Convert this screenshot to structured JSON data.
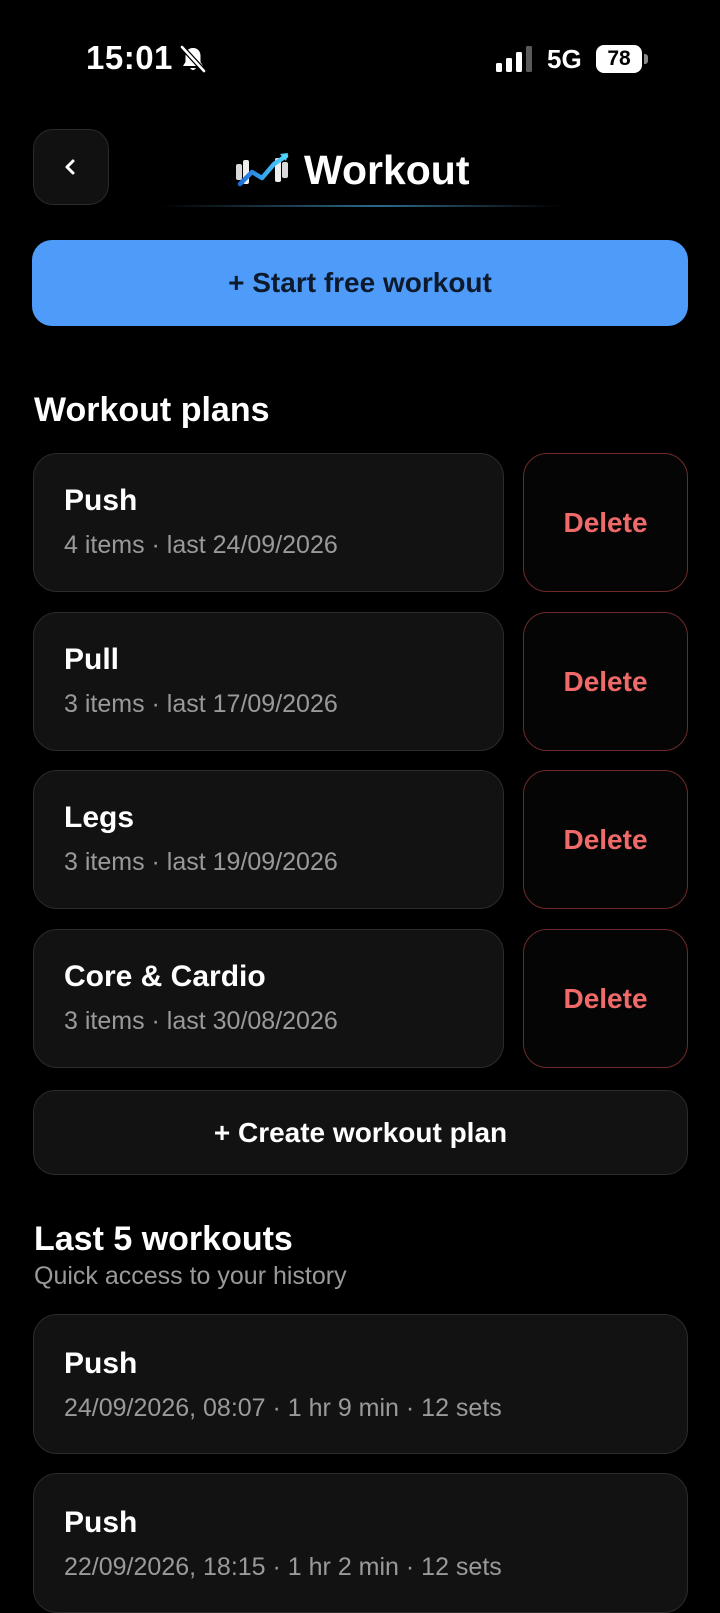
{
  "status_bar": {
    "time": "15:01",
    "network": "5G",
    "battery": "78",
    "icons": [
      "bell-slash-icon",
      "cellular-signal-icon",
      "battery-icon"
    ]
  },
  "header": {
    "back_icon": "chevron-left-icon",
    "logo_icon": "dumbbell-chart-logo-icon",
    "title": "Workout"
  },
  "start_button": {
    "label": "+ Start free workout"
  },
  "plans": {
    "title": "Workout plans",
    "delete_label": "Delete",
    "items": [
      {
        "name": "Push",
        "meta": "4 items · last 24/09/2026"
      },
      {
        "name": "Pull",
        "meta": "3 items · last 17/09/2026"
      },
      {
        "name": "Legs",
        "meta": "3 items · last 19/09/2026"
      },
      {
        "name": "Core & Cardio",
        "meta": "3 items · last 30/08/2026"
      }
    ],
    "create_label": "+ Create workout plan"
  },
  "history": {
    "title": "Last 5 workouts",
    "subtitle": "Quick access to your history",
    "items": [
      {
        "name": "Push",
        "meta": "24/09/2026, 08:07 · 1 hr 9 min · 12 sets"
      },
      {
        "name": "Push",
        "meta": "22/09/2026, 18:15 · 1 hr 2 min · 12 sets"
      }
    ]
  },
  "colors": {
    "background": "#000000",
    "accent": "#4e9bfa",
    "danger": "#f06a6a",
    "card": "#121212",
    "muted_text": "#9a9a9a"
  }
}
